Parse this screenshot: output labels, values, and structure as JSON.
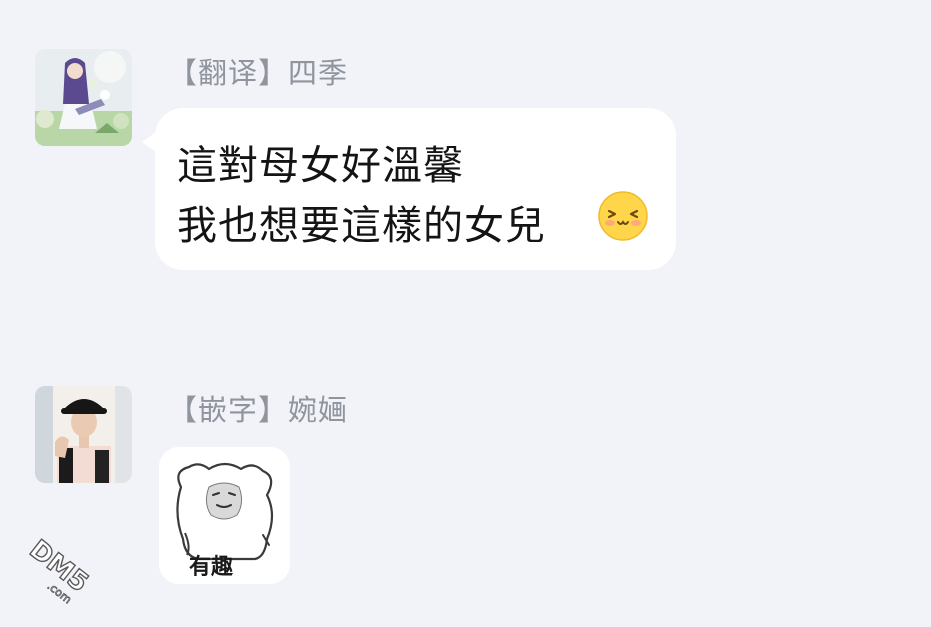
{
  "messages": [
    {
      "sender": "【翻译】四季",
      "avatar_icon": "anime-girl-avatar-icon",
      "lines": [
        "這對母女好溫馨",
        "我也想要這樣的女兒"
      ],
      "emoji_icon": "smiling-face-emoji-icon"
    },
    {
      "sender": "【嵌字】婉婳",
      "avatar_icon": "person-bucket-hat-avatar-icon",
      "sticker": {
        "icon": "bear-meme-sticker-icon",
        "caption": "有趣"
      }
    }
  ],
  "watermark": {
    "text": "DM5",
    "subtext": ".com"
  },
  "colors": {
    "background": "#f2f3f8",
    "bubble": "#ffffff",
    "sender_name": "#8f949e",
    "message_text": "#141414"
  }
}
